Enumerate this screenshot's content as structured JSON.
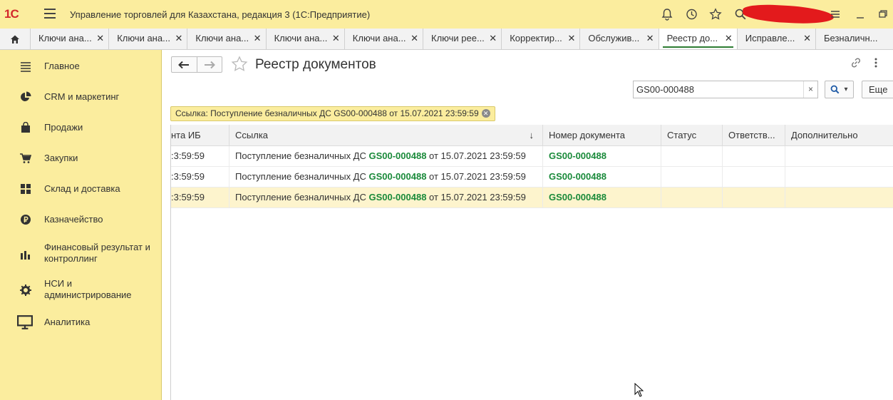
{
  "app": {
    "logo": "1С",
    "title": "Управление торговлей для Казахстана, редакция 3  (1С:Предприятие)"
  },
  "tabs": [
    {
      "label": "Ключи ана..."
    },
    {
      "label": "Ключи ана..."
    },
    {
      "label": "Ключи ана..."
    },
    {
      "label": "Ключи ана..."
    },
    {
      "label": "Ключи ана..."
    },
    {
      "label": "Ключи рее..."
    },
    {
      "label": "Корректир..."
    },
    {
      "label": "Обслужив..."
    },
    {
      "label": "Реестр до...",
      "active": true
    },
    {
      "label": "Исправле..."
    },
    {
      "label": "Безналичн..."
    }
  ],
  "sidebar": {
    "items": [
      {
        "label": "Главное",
        "icon": "menu-lines-icon"
      },
      {
        "label": "CRM и маркетинг",
        "icon": "pie-chart-icon"
      },
      {
        "label": "Продажи",
        "icon": "shopping-bag-icon"
      },
      {
        "label": "Закупки",
        "icon": "cart-icon"
      },
      {
        "label": "Склад и доставка",
        "icon": "warehouse-grid-icon"
      },
      {
        "label": "Казначейство",
        "icon": "ruble-coin-icon"
      },
      {
        "label": "Финансовый результат и контроллинг",
        "icon": "bar-chart-icon"
      },
      {
        "label": "НСИ и администрирование",
        "icon": "gear-icon"
      },
      {
        "label": "Аналитика",
        "icon": "monitor-icon"
      }
    ]
  },
  "page": {
    "title": "Реестр документов"
  },
  "search": {
    "value": "GS00-000488",
    "clear": "×"
  },
  "more_button": "Еще",
  "filter": {
    "text": "Ссылка: Поступление безналичных ДС GS00-000488 от 15.07.2021 23:59:59"
  },
  "table": {
    "columns": [
      "нта ИБ",
      "Ссылка",
      "Номер документа",
      "Статус",
      "Ответств...",
      "Дополнительно"
    ],
    "sort_indicator": "↓",
    "rows": [
      {
        "time": ":3:59:59",
        "ref_prefix": "Поступление безналичных ДС ",
        "ref_num": "GS00-000488",
        "ref_suffix": " от 15.07.2021 23:59:59",
        "doc_num": "GS00-000488",
        "status": "",
        "resp": "",
        "extra": ""
      },
      {
        "time": ":3:59:59",
        "ref_prefix": "Поступление безналичных ДС ",
        "ref_num": "GS00-000488",
        "ref_suffix": " от 15.07.2021 23:59:59",
        "doc_num": "GS00-000488",
        "status": "",
        "resp": "",
        "extra": ""
      },
      {
        "time": ":3:59:59",
        "ref_prefix": "Поступление безналичных ДС ",
        "ref_num": "GS00-000488",
        "ref_suffix": " от 15.07.2021 23:59:59",
        "doc_num": "GS00-000488",
        "status": "",
        "resp": "",
        "extra": "",
        "selected": true
      }
    ]
  },
  "colors": {
    "titlebar": "#fbed9e",
    "accent_green": "#1a8a3a",
    "selected_row": "#fdf4cd"
  }
}
